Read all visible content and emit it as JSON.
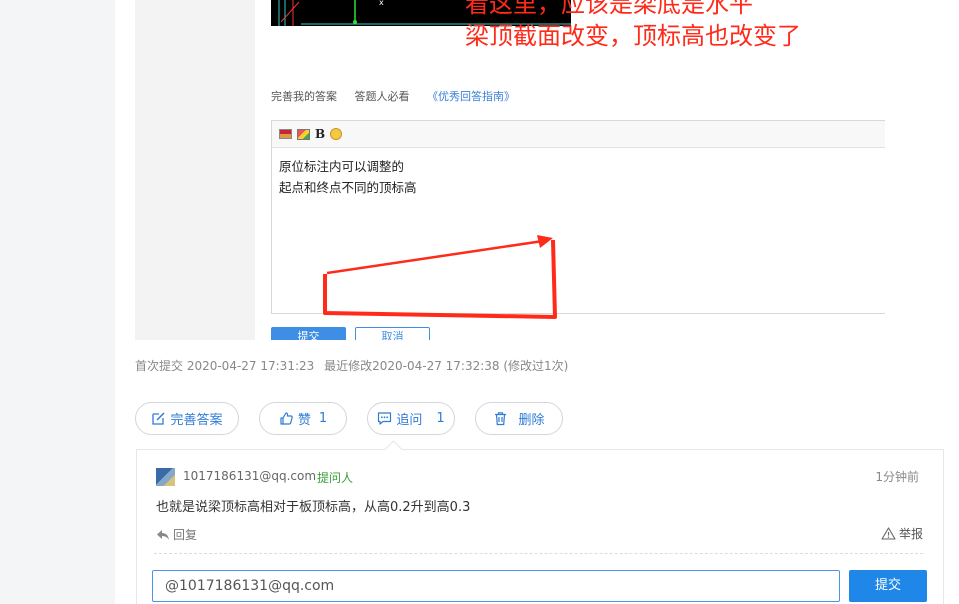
{
  "annotation": {
    "line1": "看这里，应该是梁底是水平",
    "line2": "梁顶截面改变，顶标高也改变了"
  },
  "improve_row": {
    "improve_label": "完善我的答案",
    "must_read_label": "答题人必看",
    "guide_link": "《优秀回答指南》"
  },
  "editor": {
    "line1": "原位标注内可以调整的",
    "line2": "起点和终点不同的顶标高"
  },
  "screenshot_buttons": {
    "submit": "提交",
    "cancel": "取消"
  },
  "meta": {
    "first_submit": "首次提交 2020-04-27 17:31:23",
    "last_modified": "最近修改2020-04-27 17:32:38 (修改过1次)"
  },
  "actions": {
    "complete_label": "完善答案",
    "like_label": "赞",
    "like_count": "1",
    "ask_label": "追问",
    "ask_count": "1",
    "delete_label": "删除"
  },
  "comment": {
    "user": "1017186131@qq.com",
    "role": "提问人",
    "time": "1分钟前",
    "text": "也就是说梁顶标高相对于板顶标高，从高0.2升到高0.3",
    "reply_label": "回复",
    "report_label": "举报"
  },
  "reply_box": {
    "value": "@1017186131@qq.com",
    "submit_label": "提交"
  },
  "colors": {
    "accent": "#1f87e8",
    "link": "#2f7bd6",
    "annotation_red": "#ff2a1a",
    "role_green": "#3aa03a"
  }
}
